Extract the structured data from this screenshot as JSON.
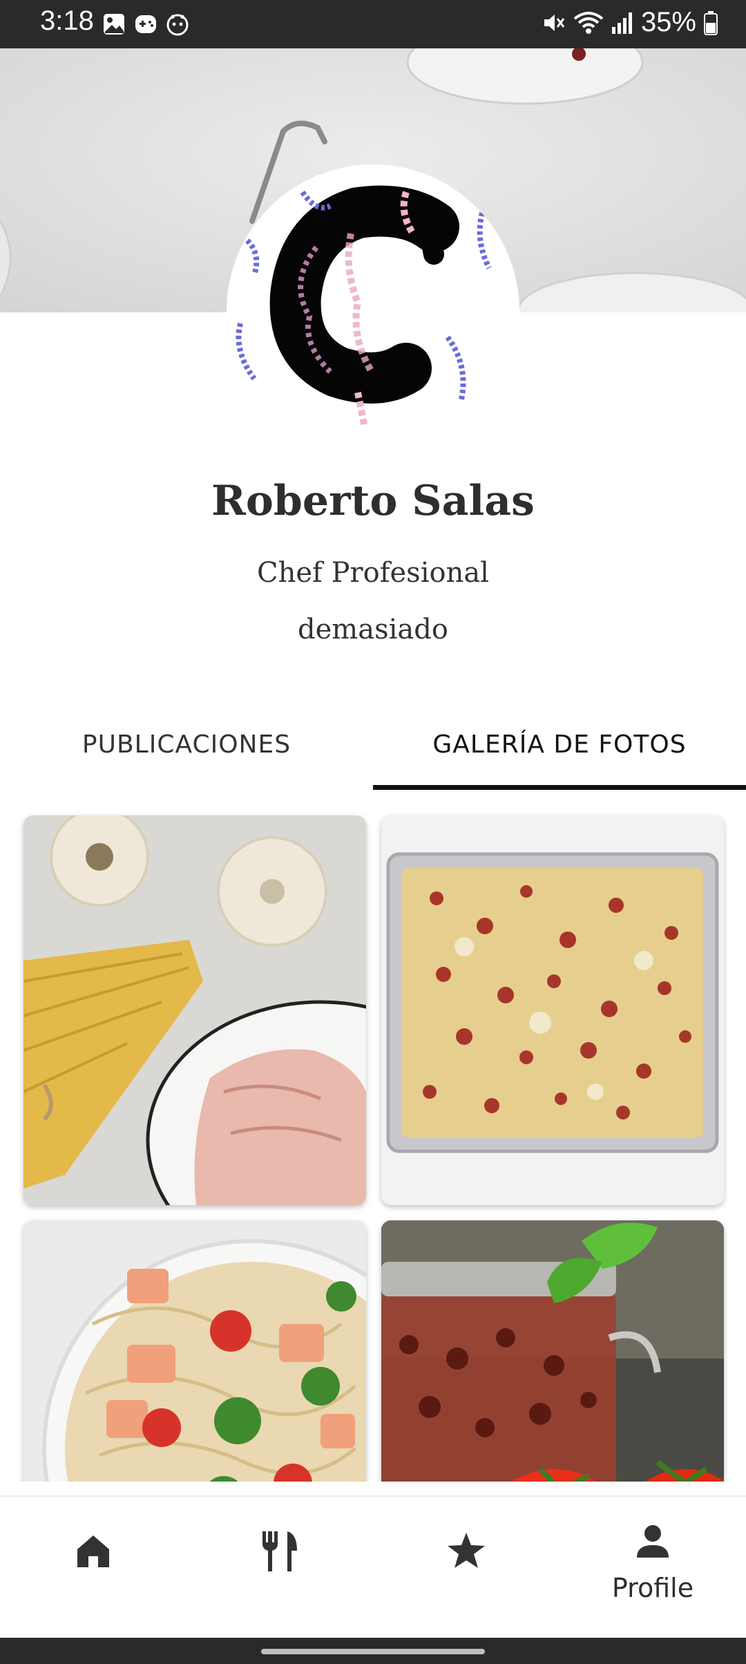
{
  "status_bar": {
    "time": "3:18",
    "battery": "35%",
    "icons": [
      "image-icon",
      "game-icon",
      "cat-icon",
      "mute-icon",
      "wifi-icon",
      "signal-icon",
      "battery-icon"
    ]
  },
  "profile": {
    "name": "Roberto Salas",
    "role": "Chef Profesional",
    "bio": "demasiado"
  },
  "tabs": [
    {
      "label": "PUBLICACIONES",
      "selected": false
    },
    {
      "label": "GALERÍA DE FOTOS",
      "selected": true
    }
  ],
  "gallery": [
    {
      "subject": "garlic, spaghetti and ham"
    },
    {
      "subject": "baked pasta with bacon"
    },
    {
      "subject": "salmon pasta with broccoli and tomatoes"
    },
    {
      "subject": "sun-dried tomatoes in jar with basil"
    }
  ],
  "bottom_nav": [
    {
      "icon": "home-icon",
      "label": ""
    },
    {
      "icon": "utensils-icon",
      "label": ""
    },
    {
      "icon": "star-icon",
      "label": ""
    },
    {
      "icon": "person-icon",
      "label": "Profile",
      "selected": true
    }
  ],
  "colors": {
    "accent": "#111111",
    "status_bar": "#2a2a2a"
  }
}
